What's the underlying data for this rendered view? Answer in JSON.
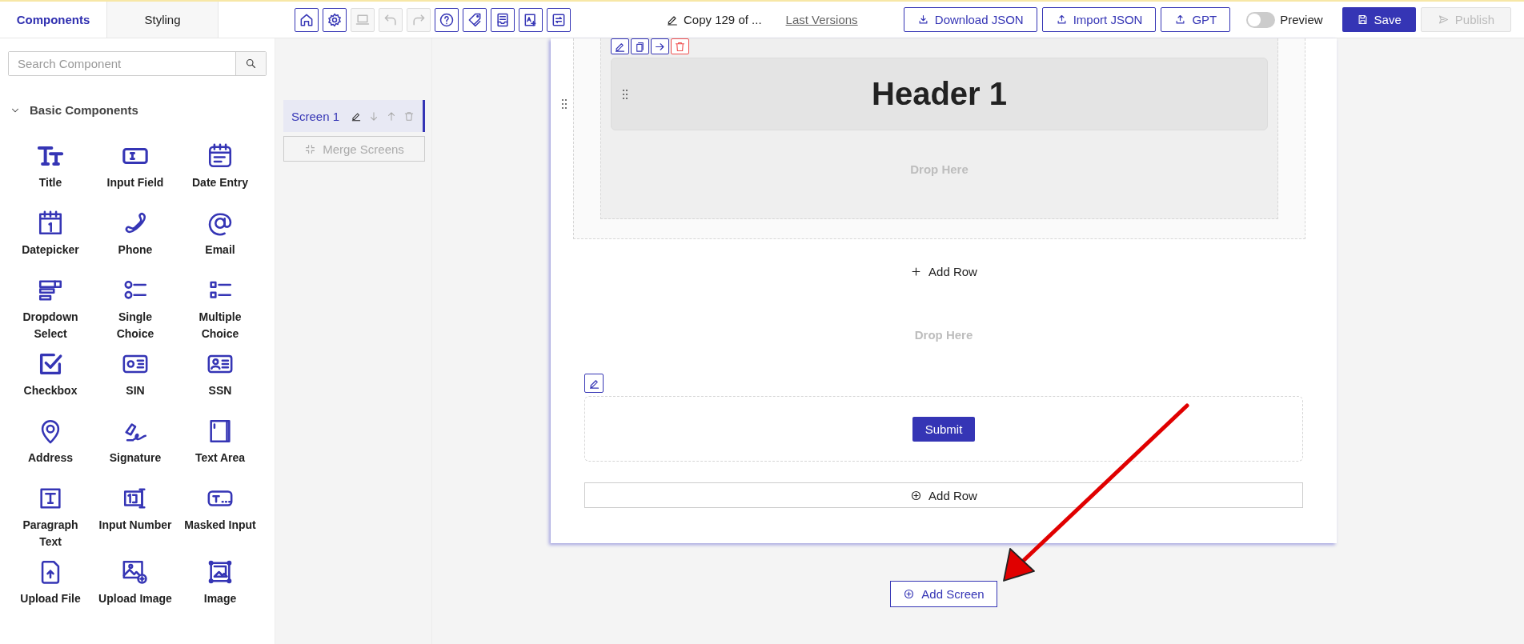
{
  "sidebar_tabs": [
    {
      "label": "Components",
      "selected": true
    },
    {
      "label": "Styling",
      "selected": false
    }
  ],
  "toolbar": [
    {
      "kind": "home",
      "disabled": false
    },
    {
      "kind": "settings",
      "disabled": false
    },
    {
      "kind": "laptop",
      "disabled": true
    },
    {
      "kind": "undo",
      "disabled": true
    },
    {
      "kind": "redo",
      "disabled": true
    },
    {
      "kind": "help",
      "disabled": false
    },
    {
      "kind": "tag",
      "disabled": false
    },
    {
      "kind": "document",
      "disabled": false
    },
    {
      "kind": "image-text",
      "disabled": false
    },
    {
      "kind": "swap",
      "disabled": false
    }
  ],
  "document_title": "Copy 129 of ...",
  "last_versions": "Last Versions",
  "actions": [
    {
      "label": "Download JSON",
      "kind": "download"
    },
    {
      "label": "Import JSON",
      "kind": "upload"
    },
    {
      "label": "GPT",
      "kind": "upload"
    }
  ],
  "preview": {
    "label": "Preview",
    "on": false
  },
  "save": {
    "label": "Save"
  },
  "publish": {
    "label": "Publish",
    "disabled": true
  },
  "search": {
    "placeholder": "Search Component"
  },
  "section": {
    "title": "Basic Components",
    "expanded": true
  },
  "components": [
    {
      "label": "Title",
      "kind": "title"
    },
    {
      "label": "Input Field",
      "kind": "input"
    },
    {
      "label": "Date Entry",
      "kind": "date"
    },
    {
      "label": "Datepicker",
      "kind": "datepicker"
    },
    {
      "label": "Phone",
      "kind": "phone"
    },
    {
      "label": "Email",
      "kind": "email"
    },
    {
      "label": "Dropdown Select",
      "kind": "dropdown"
    },
    {
      "label": "Single Choice",
      "kind": "single"
    },
    {
      "label": "Multiple Choice",
      "kind": "multiple"
    },
    {
      "label": "Checkbox",
      "kind": "checkbox"
    },
    {
      "label": "SIN",
      "kind": "sin"
    },
    {
      "label": "SSN",
      "kind": "ssn"
    },
    {
      "label": "Address",
      "kind": "address"
    },
    {
      "label": "Signature",
      "kind": "signature"
    },
    {
      "label": "Text Area",
      "kind": "textarea"
    },
    {
      "label": "Paragraph Text",
      "kind": "paragraph"
    },
    {
      "label": "Input Number",
      "kind": "number"
    },
    {
      "label": "Masked Input",
      "kind": "masked"
    },
    {
      "label": "Upload File",
      "kind": "uploadfile"
    },
    {
      "label": "Upload Image",
      "kind": "uploadimage"
    },
    {
      "label": "Image",
      "kind": "image"
    }
  ],
  "screens": [
    {
      "label": "Screen 1",
      "selected": true
    }
  ],
  "merge": {
    "label": "Merge Screens",
    "disabled": true
  },
  "canvas": {
    "header": "Header 1",
    "drop_hints": [
      "Drop Here",
      "Drop Here"
    ],
    "add_row_link": "Add Row",
    "submit": "Submit",
    "add_row_button": "Add Row"
  },
  "add_screen": "Add Screen"
}
